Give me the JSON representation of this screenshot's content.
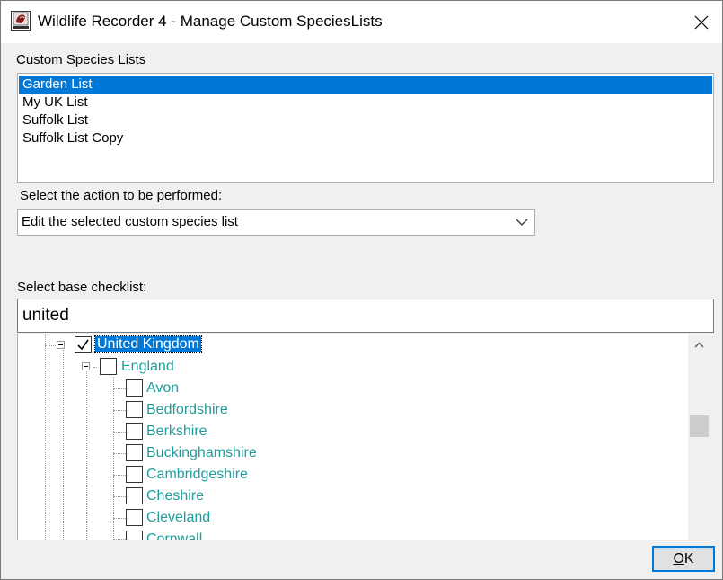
{
  "window": {
    "title": "Wildlife Recorder 4 - Manage Custom SpeciesLists",
    "app_icon": "wildlife-recorder-icon",
    "close_icon": "close-icon"
  },
  "custom_lists": {
    "label": "Custom Species Lists",
    "items": [
      {
        "label": "Garden List",
        "selected": true
      },
      {
        "label": "My UK List",
        "selected": false
      },
      {
        "label": "Suffolk List",
        "selected": false
      },
      {
        "label": "Suffolk List Copy",
        "selected": false
      }
    ]
  },
  "action": {
    "label": "Select the action to be performed:",
    "value": "Edit the selected custom species list",
    "dropdown_icon": "chevron-down-icon"
  },
  "checklist": {
    "label": "Select base checklist:",
    "search_value": "united",
    "tree": [
      {
        "label": "United Kingdom",
        "checked": true,
        "expanded": true,
        "selected": true
      },
      {
        "label": "England",
        "checked": false,
        "expanded": true,
        "selected": false
      },
      {
        "label": "Avon",
        "checked": false
      },
      {
        "label": "Bedfordshire",
        "checked": false
      },
      {
        "label": "Berkshire",
        "checked": false
      },
      {
        "label": "Buckinghamshire",
        "checked": false
      },
      {
        "label": "Cambridgeshire",
        "checked": false
      },
      {
        "label": "Cheshire",
        "checked": false
      },
      {
        "label": "Cleveland",
        "checked": false
      },
      {
        "label": "Cornwall",
        "checked": false
      }
    ]
  },
  "footer": {
    "ok_label": "OK",
    "ok_mnemonic": "O"
  },
  "colors": {
    "selection": "#0078d7",
    "tree_text": "#1f9c9c",
    "dialog_bg": "#f0f0f0"
  }
}
